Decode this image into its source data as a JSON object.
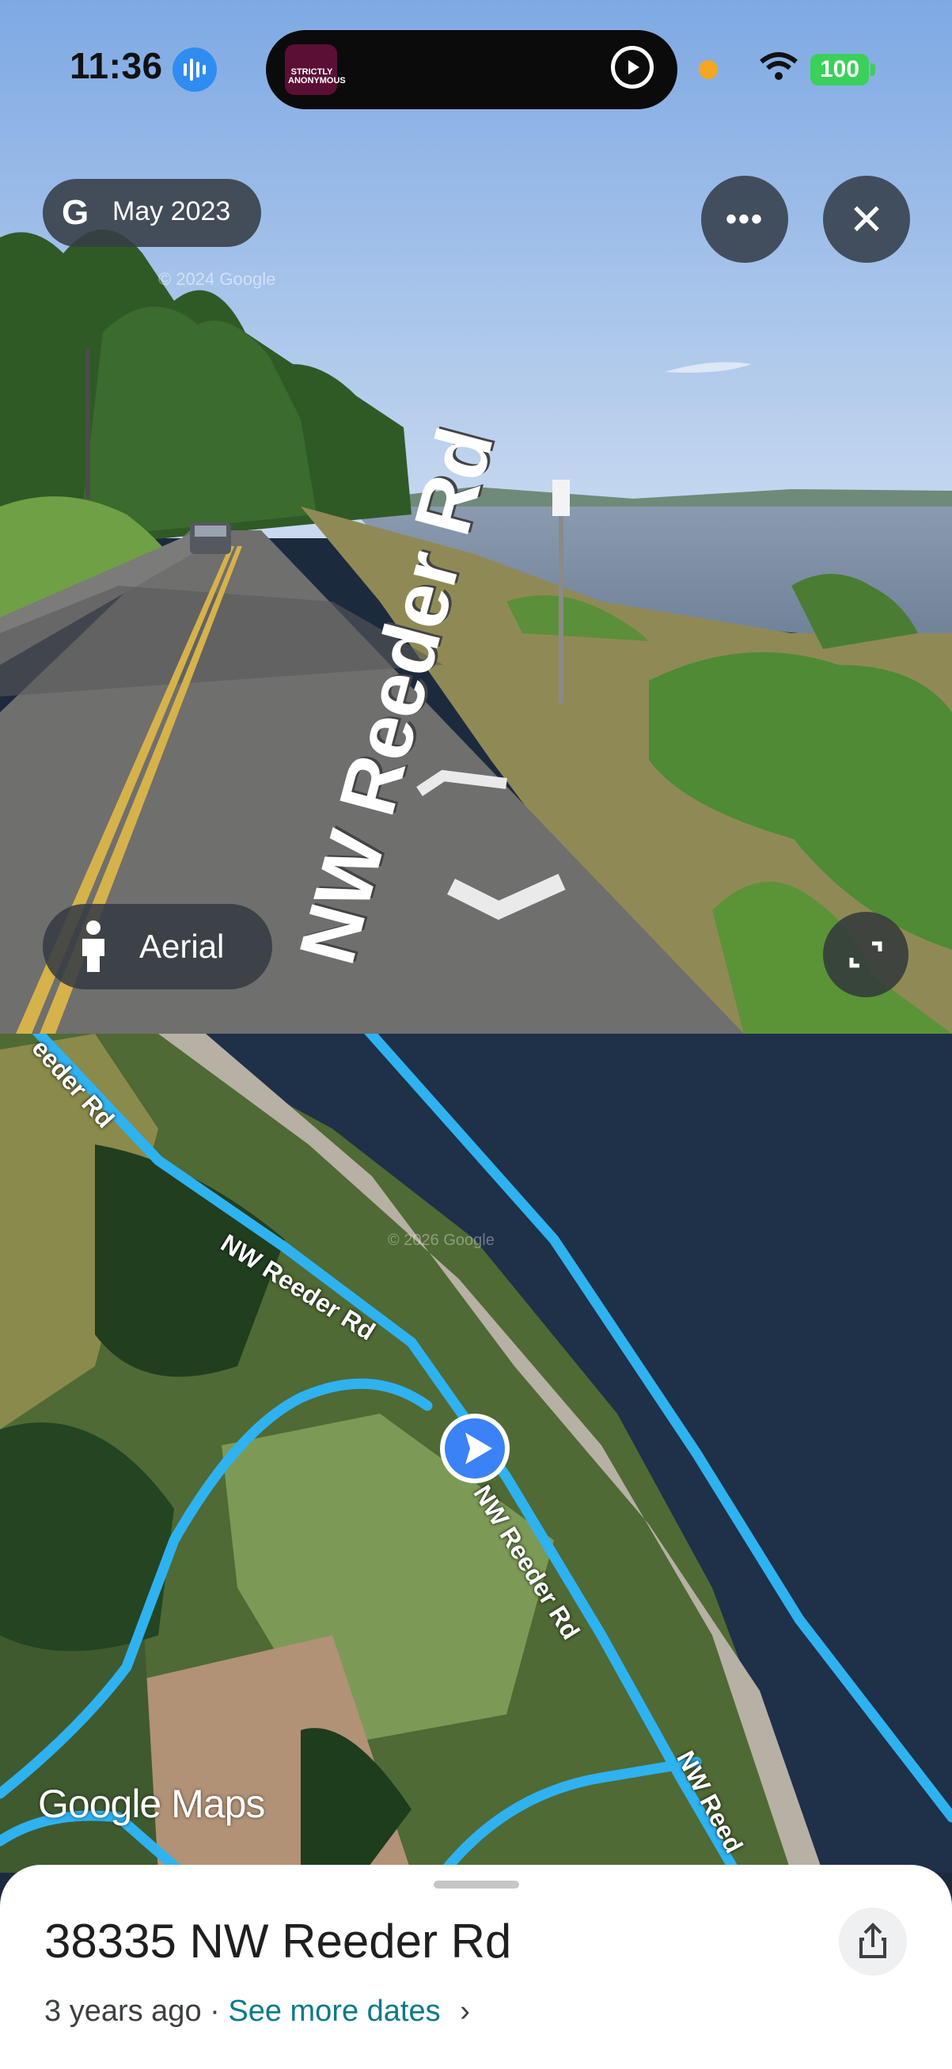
{
  "status_bar": {
    "time": "11:36",
    "battery": "100"
  },
  "now_playing": {
    "art_text": "STRICTLY ANONYMOUS"
  },
  "street_view": {
    "date_label": "May 2023",
    "road_label": "NW Reeder Rd",
    "aerial_label": "Aerial",
    "watermark": "© 2024 Google"
  },
  "map": {
    "road_labels": [
      "eeder Rd",
      "NW Reeder Rd",
      "NW Reeder Rd",
      "NW Reed"
    ],
    "brand": "Google Maps",
    "watermark": "© 2026 Google"
  },
  "sheet": {
    "address": "38335 NW Reeder Rd",
    "ago": "3 years ago",
    "separator": " · ",
    "more_dates": "See more dates",
    "chevron": "›"
  },
  "icons": [
    "google-g-icon",
    "more-icon",
    "close-icon",
    "pegman-icon",
    "expand-icon",
    "navigation-arrow-icon",
    "share-icon",
    "chevron-right-icon",
    "wifi-icon",
    "play-icon",
    "siri-icon"
  ],
  "colors": {
    "road_blue": "#2fb2f0",
    "link_teal": "#0b7a8a",
    "location_blue": "#3b82f6",
    "battery_green": "#3ad05a"
  }
}
